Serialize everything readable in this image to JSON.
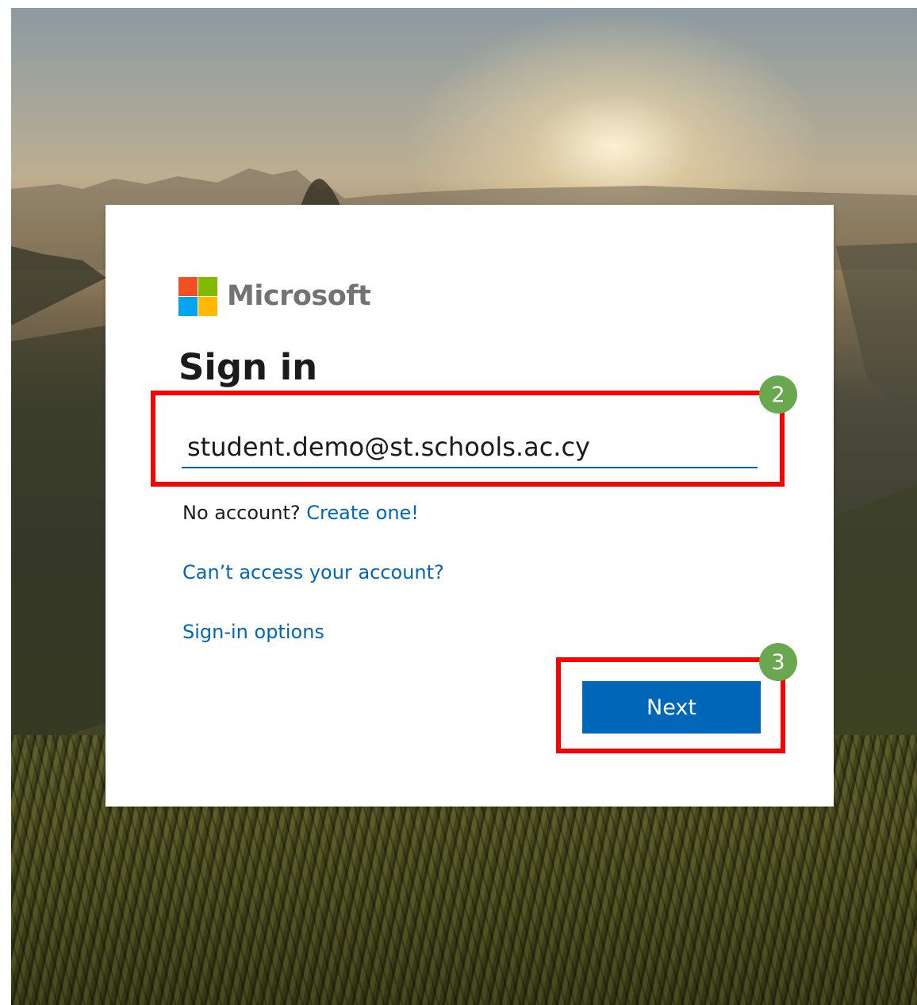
{
  "brand": {
    "logo_text": "Microsoft",
    "colors": [
      "#f25022",
      "#7fba00",
      "#00a4ef",
      "#ffb900"
    ]
  },
  "signin": {
    "title": "Sign in",
    "email_value": "student.demo@st.schools.ac.cy",
    "no_account_text": "No account?",
    "create_link": "Create one!",
    "cant_access_link": "Can’t access your account?",
    "options_link": "Sign-in options",
    "next_label": "Next"
  },
  "annotations": {
    "step_email": "2",
    "step_next": "3",
    "highlight_color": "#ff0000",
    "badge_color": "#6aa84f"
  },
  "theme": {
    "accent": "#0067b8"
  }
}
